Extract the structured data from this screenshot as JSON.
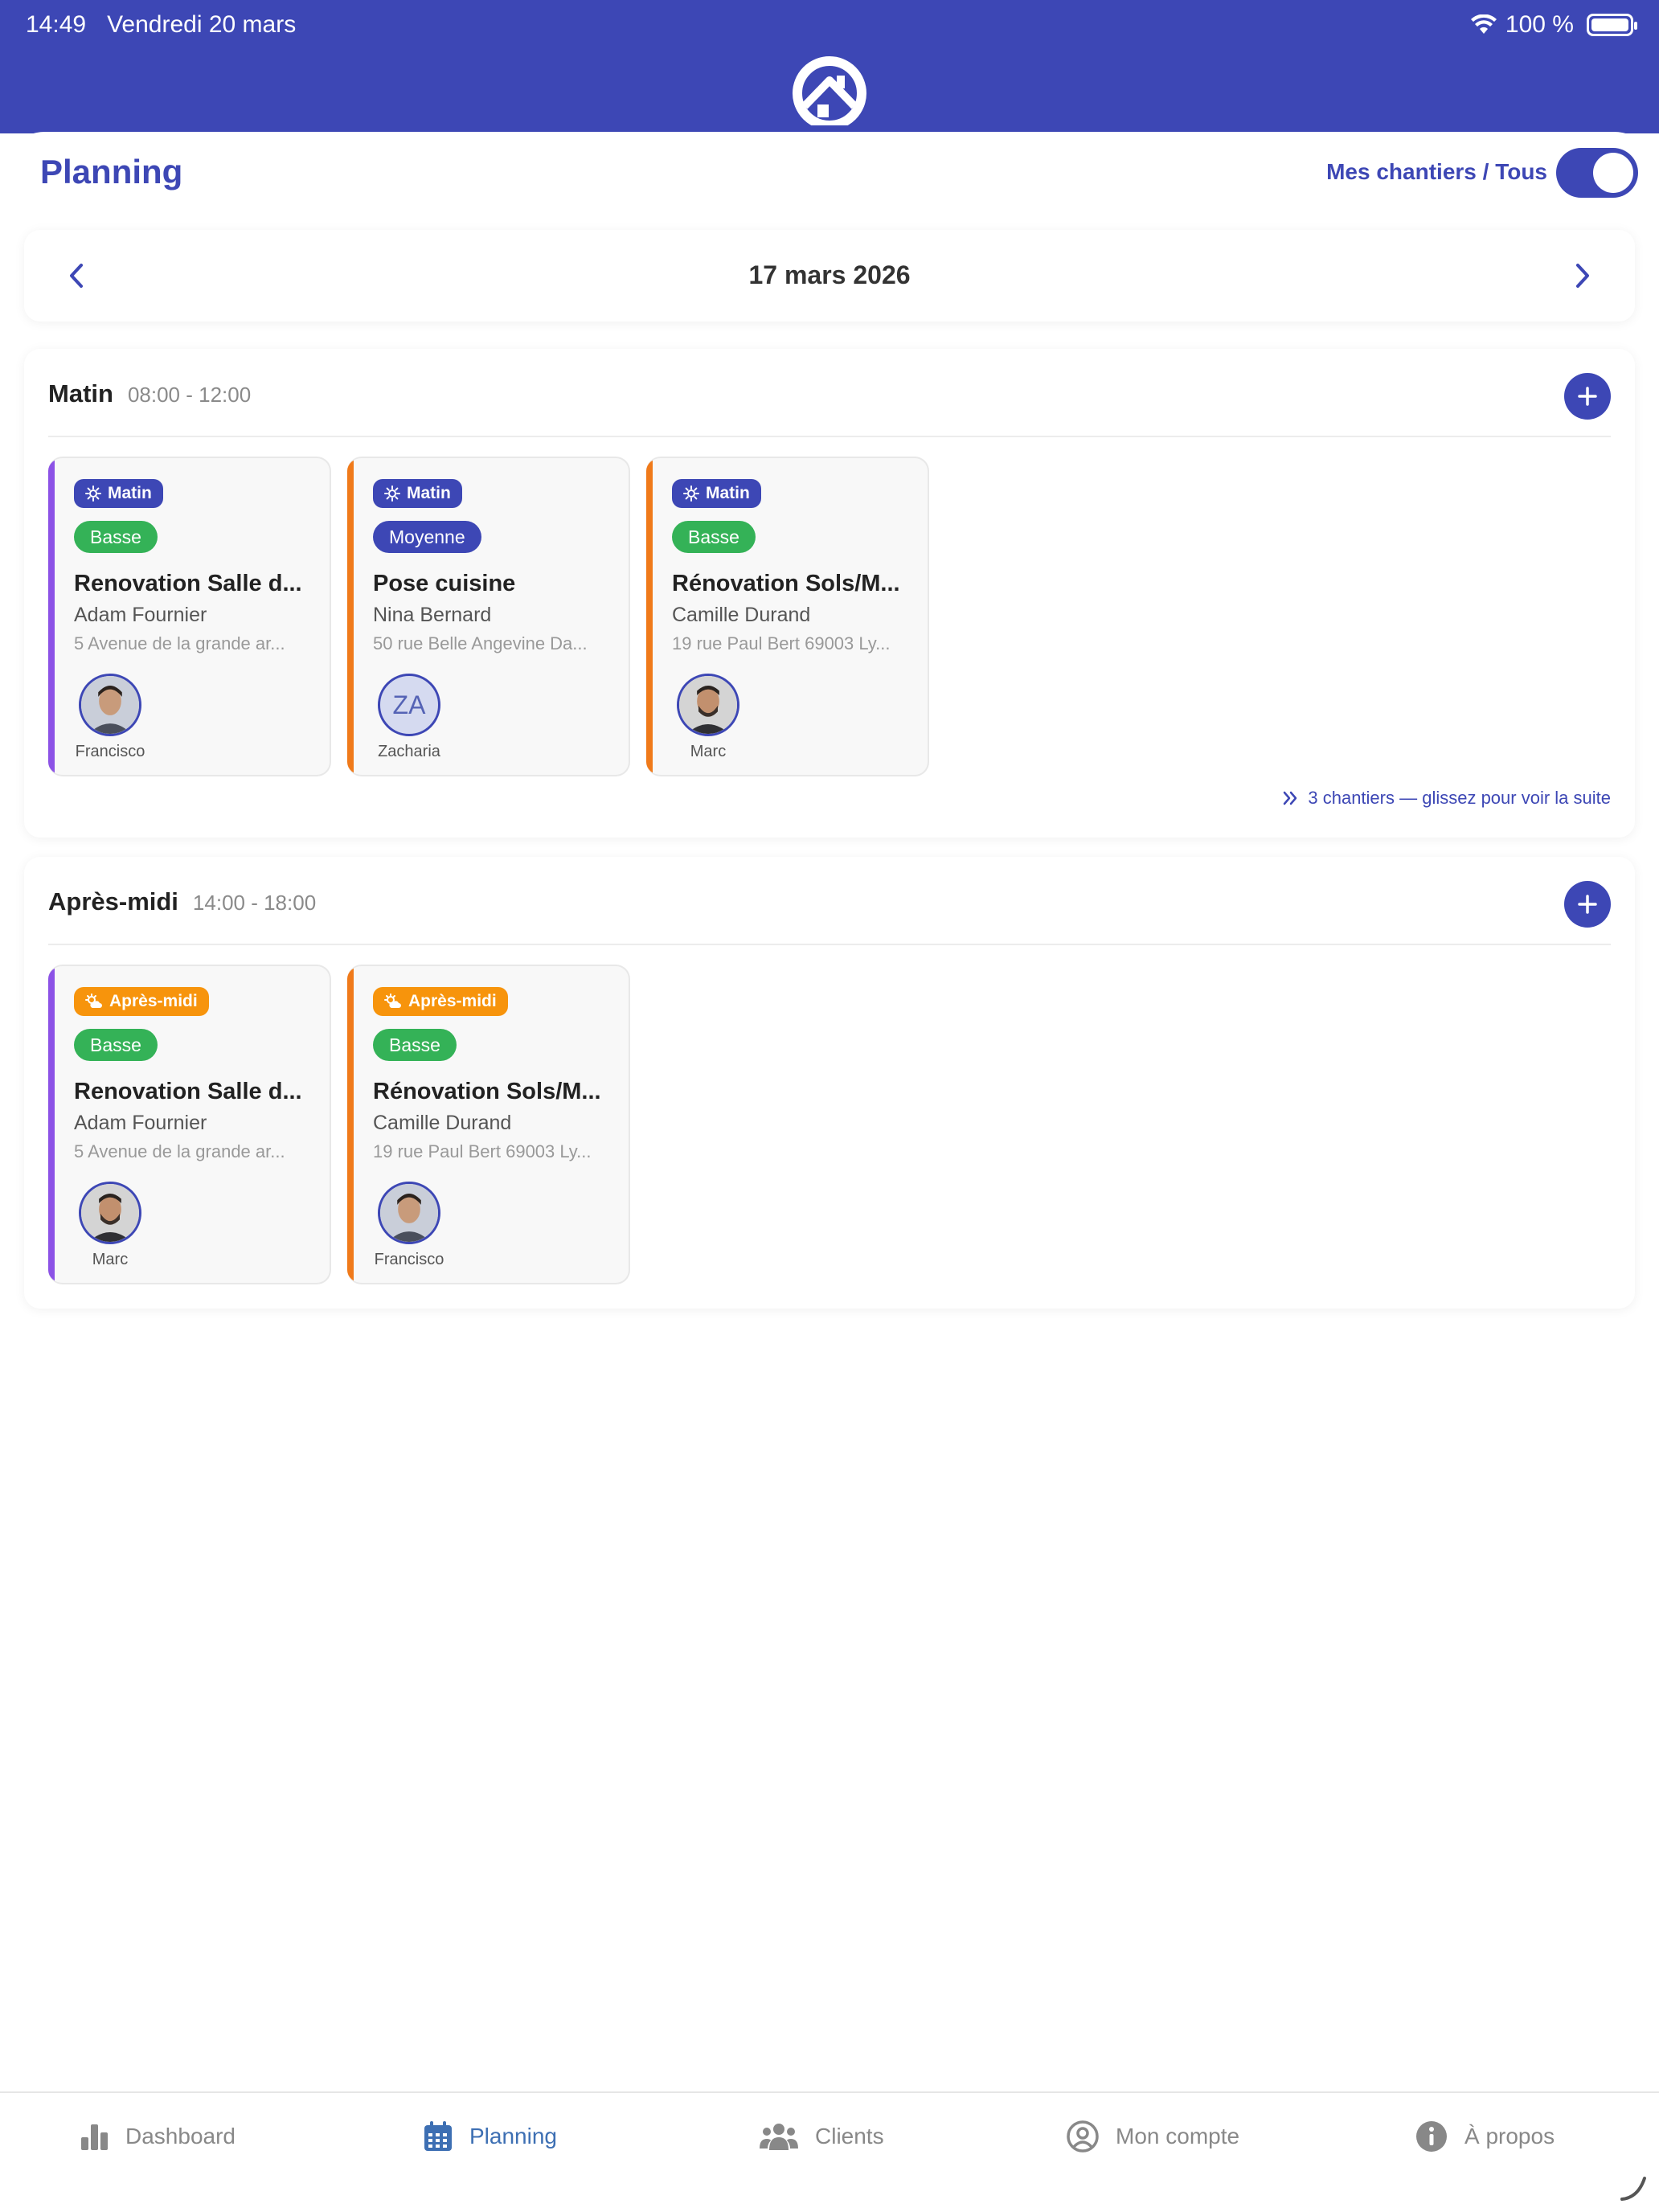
{
  "status_bar": {
    "time": "14:49",
    "date": "Vendredi 20 mars",
    "battery": "100 %"
  },
  "header": {
    "title": "Planning",
    "toggle_label": "Mes chantiers / Tous",
    "toggle_on": true
  },
  "date_nav": {
    "date": "17 mars 2026"
  },
  "sections": [
    {
      "title": "Matin",
      "time": "08:00 - 12:00",
      "hint": "3 chantiers — glissez pour voir la suite",
      "cards": [
        {
          "slot": "Matin",
          "priority": "Basse",
          "title": "Renovation Salle d...",
          "client": "Adam Fournier",
          "address": "5 Avenue de la grande ar...",
          "worker": "Francisco"
        },
        {
          "slot": "Matin",
          "priority": "Moyenne",
          "title": "Pose cuisine",
          "client": "Nina Bernard",
          "address": "50 rue Belle Angevine Da...",
          "worker": "Zacharia",
          "initials": "ZA"
        },
        {
          "slot": "Matin",
          "priority": "Basse",
          "title": "Rénovation Sols/M...",
          "client": "Camille Durand",
          "address": "19 rue Paul Bert 69003 Ly...",
          "worker": "Marc"
        }
      ]
    },
    {
      "title": "Après-midi",
      "time": "14:00 - 18:00",
      "cards": [
        {
          "slot": "Après-midi",
          "priority": "Basse",
          "title": "Renovation Salle d...",
          "client": "Adam Fournier",
          "address": "5 Avenue de la grande ar...",
          "worker": "Marc"
        },
        {
          "slot": "Après-midi",
          "priority": "Basse",
          "title": "Rénovation Sols/M...",
          "client": "Camille Durand",
          "address": "19 rue Paul Bert 69003 Ly...",
          "worker": "Francisco"
        }
      ]
    }
  ],
  "tabs": [
    {
      "label": "Dashboard",
      "icon": "bar-chart-icon"
    },
    {
      "label": "Planning",
      "icon": "calendar-icon",
      "active": true
    },
    {
      "label": "Clients",
      "icon": "users-icon"
    },
    {
      "label": "Mon compte",
      "icon": "user-circle-icon"
    },
    {
      "label": "À propos",
      "icon": "info-icon"
    }
  ],
  "colors": {
    "brand": "#3d47b5",
    "priority_low": "#34b257",
    "priority_medium": "#3d47b5",
    "slot_afternoon": "#f7940c",
    "stripe_purple": "#8c52e6",
    "stripe_orange": "#f07a1a",
    "tab_active": "#3d6fb3"
  }
}
